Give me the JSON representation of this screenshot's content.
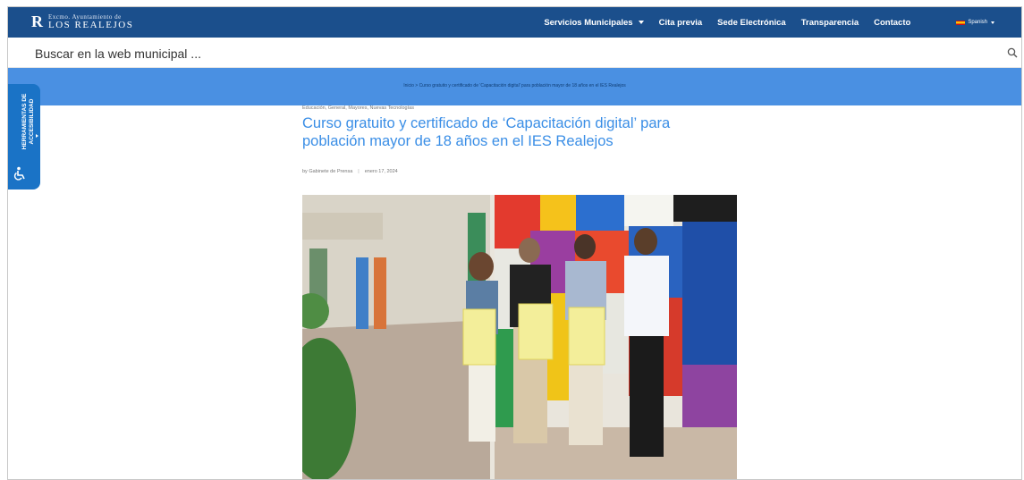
{
  "header": {
    "logo_mark": "R",
    "logo_small": "Excmo. Ayuntamiento de",
    "logo_big": "LOS REALEJOS",
    "nav": [
      {
        "label": "Servicios Municipales",
        "dropdown": true
      },
      {
        "label": "Cita previa"
      },
      {
        "label": "Sede Electrónica"
      },
      {
        "label": "Transparencia"
      },
      {
        "label": "Contacto"
      }
    ],
    "language": "Spanish"
  },
  "search": {
    "placeholder": "Buscar en la web municipal ..."
  },
  "breadcrumb": {
    "text": "Inicio > Curso gratuito y certificado de 'Capacitación digital' para población mayor de 18 años en el IES Realejos"
  },
  "accessibility": {
    "label_line1": "HERRAMIENTAS DE",
    "label_line2": "ACCESIBILIDAD"
  },
  "article": {
    "categories": "Educación, General, Mayores, Nuevas Tecnologías",
    "title": "Curso gratuito y certificado de ‘Capacitación digital’ para población mayor de 18 años en el IES Realejos",
    "author": "by Gabinete de Prensa",
    "separator": "|",
    "date": "enero 17, 2024"
  },
  "colors": {
    "nav_bg": "#1b4f8c",
    "breadcrumb_bg": "#4a90e2",
    "title": "#3a8ee6",
    "a11y_bg": "#1a73c6"
  }
}
